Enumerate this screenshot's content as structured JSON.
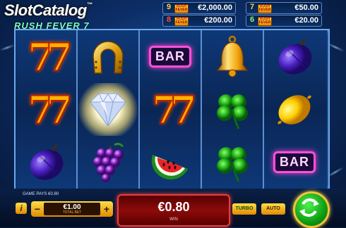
{
  "logo": {
    "brand": "SlotCatalog",
    "trademark": "™",
    "game_title": "RUSH FEVER 7"
  },
  "jackpots": [
    {
      "level": "9",
      "amount": "€2,000.00",
      "color": "#ffd24a"
    },
    {
      "level": "7",
      "amount": "€50.00",
      "color": "#ffd24a"
    },
    {
      "level": "8",
      "amount": "€200.00",
      "color": "#ff4a4a"
    },
    {
      "level": "6",
      "amount": "€20.00",
      "color": "#7aff7a"
    }
  ],
  "jackpot_icon_text": "RUSH FEVER",
  "reels": [
    [
      "seven",
      "seven",
      "plum"
    ],
    [
      "horseshoe",
      "diamond",
      "grapes"
    ],
    [
      "bar",
      "seven",
      "watermelon"
    ],
    [
      "bell",
      "clover",
      "clover"
    ],
    [
      "plum",
      "lemon",
      "bar"
    ]
  ],
  "symbols": {
    "seven_label": "7",
    "bar_label": "BAR"
  },
  "status": {
    "game_pays": "GAME PAYS €0.80"
  },
  "bet": {
    "info_label": "i",
    "minus_label": "−",
    "plus_label": "+",
    "amount": "€1.00",
    "label": "TOTAL BET"
  },
  "win": {
    "amount": "€0.80",
    "label": "WIN"
  },
  "controls": {
    "turbo_label": "TURBO",
    "auto_label": "AUTO"
  },
  "colors": {
    "accent_gold": "#f3c437",
    "spin_green": "#19b51c",
    "win_red": "#8c0b0b"
  }
}
